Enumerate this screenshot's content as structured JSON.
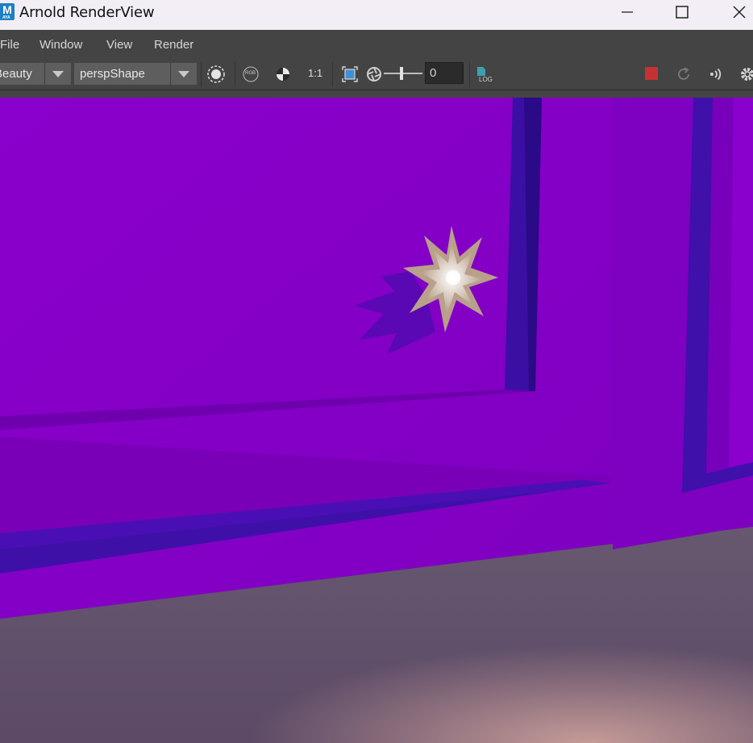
{
  "window": {
    "title": "Arnold RenderView",
    "app_icon_letter": "M",
    "app_icon_sub": "AYA"
  },
  "menu": {
    "items": [
      "File",
      "Window",
      "View",
      "Render"
    ]
  },
  "toolbar": {
    "aov": "Beauty",
    "camera": "perspShape",
    "ratio_label": "1:1",
    "exposure_value": "0",
    "rgb_label": "RGB",
    "log_label": "LOG",
    "stop_color": "#c53232"
  },
  "icons": {
    "titlebar": [
      "app-icon",
      "minimize-icon",
      "maximize-icon",
      "close-icon"
    ],
    "toolbar": [
      "chevron-down-icon",
      "chevron-down-icon",
      "render-region-icon",
      "rgb-channel-icon",
      "checker-icon",
      "fit-frame-icon",
      "aperture-icon",
      "log-icon",
      "stop-icon",
      "refresh-icon",
      "ipr-broadcast-icon",
      "gear-icon"
    ]
  },
  "render": {
    "wall_color": "#8800c8",
    "floor_color": "#6a5870"
  }
}
